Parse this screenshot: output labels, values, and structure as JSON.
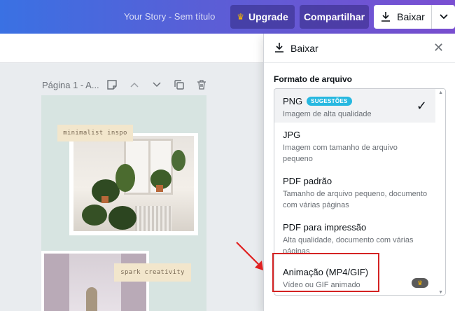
{
  "header": {
    "doc_title": "Your Story - Sem título",
    "upgrade_label": "Upgrade",
    "share_label": "Compartilhar",
    "download_label": "Baixar",
    "accent_gradient": [
      "#3a71e3",
      "#7a4fd2"
    ]
  },
  "page": {
    "label": "Página 1 - A...",
    "tools": [
      "note-icon",
      "chevron-up-icon",
      "chevron-down-icon",
      "copy-icon",
      "trash-icon"
    ]
  },
  "canvas": {
    "tag_top": "minimalist inspo",
    "tag_bottom": "spark creativity",
    "background": "#d7e4e1"
  },
  "download_panel": {
    "title": "Baixar",
    "format_label": "Formato de arquivo",
    "formats": [
      {
        "title": "PNG",
        "badge": "SUGESTÕES",
        "desc": "Imagem de alta qualidade",
        "selected": true
      },
      {
        "title": "JPG",
        "desc": "Imagem com tamanho de arquivo pequeno"
      },
      {
        "title": "PDF padrão",
        "desc": "Tamanho de arquivo pequeno, documento com várias páginas"
      },
      {
        "title": "PDF para impressão",
        "desc": "Alta qualidade, documento com várias páginas"
      },
      {
        "title": "Animação (MP4/GIF)",
        "desc": "Vídeo ou GIF animado",
        "pro": true
      }
    ]
  },
  "annotation": {
    "highlight_color": "#d42323"
  }
}
